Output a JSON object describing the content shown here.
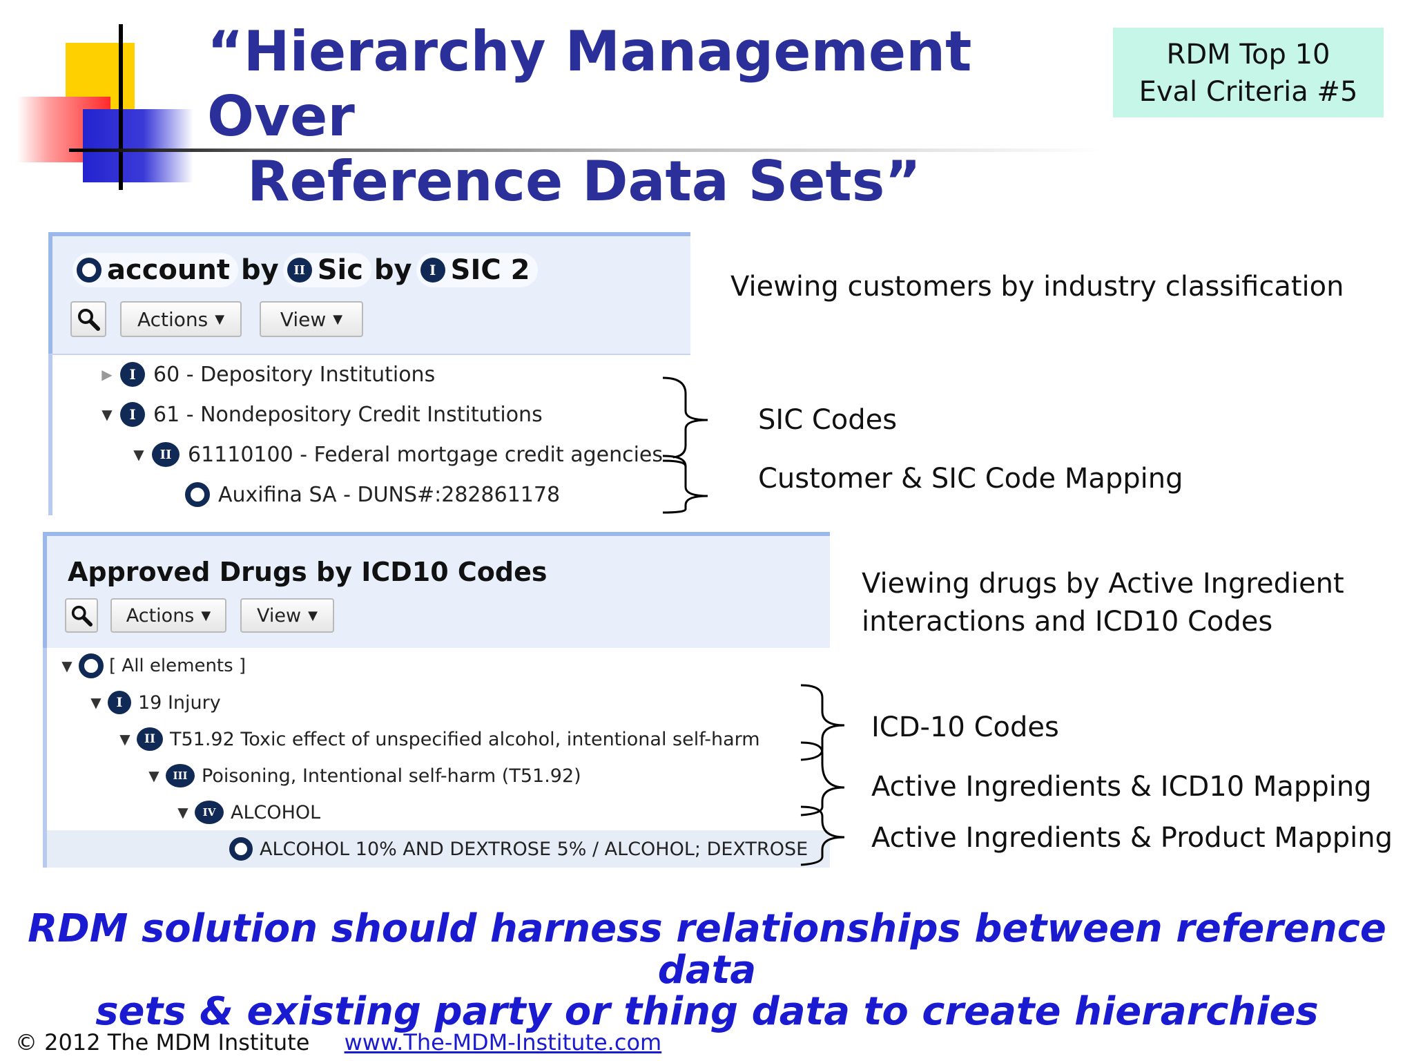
{
  "slide": {
    "title_line1": "“Hierarchy Management Over",
    "title_line2": "Reference Data Sets”",
    "badge_line1": "RDM Top 10",
    "badge_line2": "Eval Criteria #5",
    "tagline_line1": "RDM solution should harness relationships between reference data",
    "tagline_line2": "sets & existing party or thing data to create hierarchies",
    "footer_copyright": "© 2012 The MDM Institute",
    "footer_link": "www.The-MDM-Institute.com"
  },
  "panel1": {
    "header": {
      "seg1_badge": "",
      "seg1_label": "account",
      "by1": "by",
      "seg2_badge": "II",
      "seg2_label": "Sic",
      "by2": "by",
      "seg3_badge": "I",
      "seg3_label": "SIC 2"
    },
    "toolbar": {
      "actions_label": "Actions",
      "view_label": "View"
    },
    "rows": [
      {
        "badge": "I",
        "label": "60 - Depository Institutions"
      },
      {
        "badge": "I",
        "label": "61 - Nondepository Credit Institutions"
      },
      {
        "badge": "II",
        "label": "61110100 - Federal mortgage credit agencies"
      },
      {
        "badge": "",
        "label": "Auxifina SA - DUNS#:282861178"
      }
    ],
    "note": "Viewing customers by industry classification",
    "bracket_labels": [
      "SIC Codes",
      "Customer & SIC Code Mapping"
    ]
  },
  "panel2": {
    "header": {
      "title": "Approved Drugs by ICD10 Codes"
    },
    "toolbar": {
      "actions_label": "Actions",
      "view_label": "View"
    },
    "rows": [
      {
        "badge": "",
        "label": "[ All elements ]"
      },
      {
        "badge": "I",
        "label": "19 Injury"
      },
      {
        "badge": "II",
        "label": "T51.92 Toxic effect of unspecified alcohol, intentional self-harm"
      },
      {
        "badge": "III",
        "label": "Poisoning, Intentional self-harm (T51.92)"
      },
      {
        "badge": "IV",
        "label": "ALCOHOL"
      },
      {
        "badge": "",
        "label": "ALCOHOL 10% AND DEXTROSE 5% / ALCOHOL; DEXTROSE"
      }
    ],
    "note_line1": "Viewing drugs by Active Ingredient",
    "note_line2": "interactions and ICD10 Codes",
    "bracket_labels": [
      "ICD-10 Codes",
      "Active Ingredients & ICD10 Mapping",
      "Active Ingredients & Product Mapping"
    ]
  }
}
